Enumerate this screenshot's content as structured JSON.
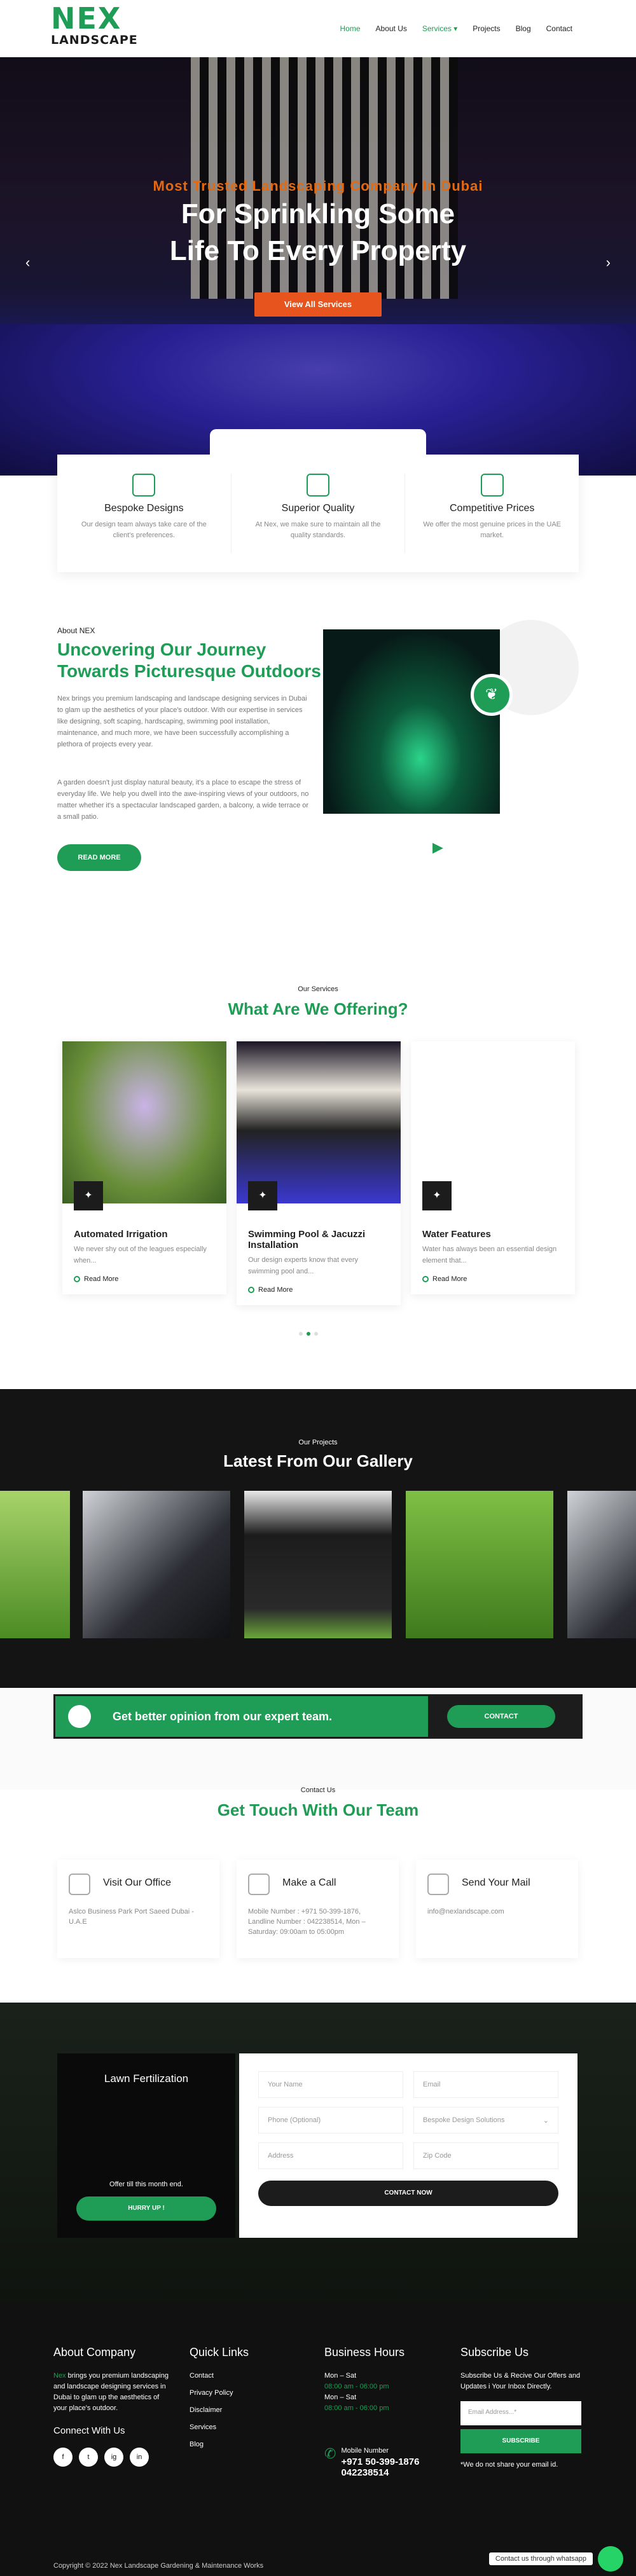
{
  "header": {
    "logo_top": "NEX",
    "logo_bottom": "LANDSCAPE",
    "nav": [
      "Home",
      "About Us",
      "Services ▾",
      "Projects",
      "Blog",
      "Contact"
    ]
  },
  "hero": {
    "kicker": "Most Trusted Landscaping Company In Dubai",
    "title_line1": "For Sprinkling Some",
    "title_line2": "Life To Every Property",
    "button": "View All Services"
  },
  "features": [
    {
      "icon": "design-icon",
      "title": "Bespoke Designs",
      "desc": "Our design team always take care of the client's preferences."
    },
    {
      "icon": "quality-icon",
      "title": "Superior Quality",
      "desc": "At Nex, we make sure to maintain all the quality standards."
    },
    {
      "icon": "price-icon",
      "title": "Competitive Prices",
      "desc": "We offer the most genuine prices in the UAE market."
    }
  ],
  "about": {
    "kicker": "About NEX",
    "title": "Uncovering Our Journey Towards Picturesque Outdoors",
    "p1": "Nex brings you premium landscaping and landscape designing services in Dubai to glam up the aesthetics of your place's outdoor. With our expertise in services like designing, soft scaping, hardscaping, swimming pool installation, maintenance, and much more, we have been successfully accomplishing a plethora of projects every year.",
    "p2": "A garden doesn't just display natural beauty, it's a place to escape the stress of everyday life. We help you dwell into the awe-inspiring views of your outdoors, no matter whether it's a spectacular landscaped garden, a balcony, a wide terrace or a small patio.",
    "button": "READ MORE"
  },
  "services": {
    "kicker": "Our Services",
    "title": "What Are We Offering?",
    "items": [
      {
        "title": "Automated Irrigation",
        "desc": "We never shy out of the leagues especially when...",
        "more": "Read More"
      },
      {
        "title": "Swimming Pool & Jacuzzi Installation",
        "desc": "Our design experts know that every swimming pool and...",
        "more": "Read More"
      },
      {
        "title": "Water Features",
        "desc": "Water has always been an essential design element that...",
        "more": "Read More"
      }
    ]
  },
  "gallery": {
    "kicker": "Our Projects",
    "title": "Latest From Our Gallery"
  },
  "cta": {
    "text": "Get better opinion from our expert team.",
    "button": "CONTACT"
  },
  "contact": {
    "kicker": "Contact Us",
    "title": "Get Touch With Our Team",
    "boxes": [
      {
        "title": "Visit Our Office",
        "text": "Aslco Business Park Port Saeed Dubai - U.A.E"
      },
      {
        "title": "Make a Call",
        "text": "Mobile Number : +971 50-399-1876, Landline Number : 042238514, Mon – Saturday: 09:00am to 05:00pm"
      },
      {
        "title": "Send Your Mail",
        "text": "info@nexlandscape.com"
      }
    ]
  },
  "lawn": {
    "title": "Lawn Fertilization",
    "offer": "Offer till this month end.",
    "button": "HURRY UP !"
  },
  "form": {
    "name": "Your Name",
    "email": "Email",
    "phone": "Phone (Optional)",
    "service": "Bespoke Design Solutions",
    "address": "Address",
    "zip": "Zip Code",
    "submit": "CONTACT NOW"
  },
  "footer": {
    "about_title": "About Company",
    "about_brand": "Nex",
    "about_text": "brings you premium landscaping and landscape designing services in Dubai to glam up the aesthetics of your place's outdoor.",
    "connect_title": "Connect With Us",
    "social": [
      "f",
      "t",
      "ig",
      "in"
    ],
    "links_title": "Quick Links",
    "links": [
      "Contact",
      "Privacy Policy",
      "Disclaimer",
      "Services",
      "Blog"
    ],
    "hours_title": "Business Hours",
    "hours_days1": "Mon – Sat",
    "hours_time1": "08:00 am - 06:00 pm",
    "hours_days2": "Mon – Sat",
    "hours_time2": "08:00 am - 06:00 pm",
    "mobile_label": "Mobile Number",
    "mobile": "+971 50-399-1876",
    "landline": "042238514",
    "subscribe_title": "Subscribe Us",
    "subscribe_text": "Subscribe Us & Recive Our Offers and Updates i Your Inbox Directly.",
    "email_placeholder": "Email Address...*",
    "subscribe_btn": "SUBSCRIBE",
    "note": "*We do not share your email id.",
    "copyright": "Copyright © 2022 Nex Landscape Gardening & Maintenance Works",
    "whatsapp": "Contact us through whatsapp"
  }
}
